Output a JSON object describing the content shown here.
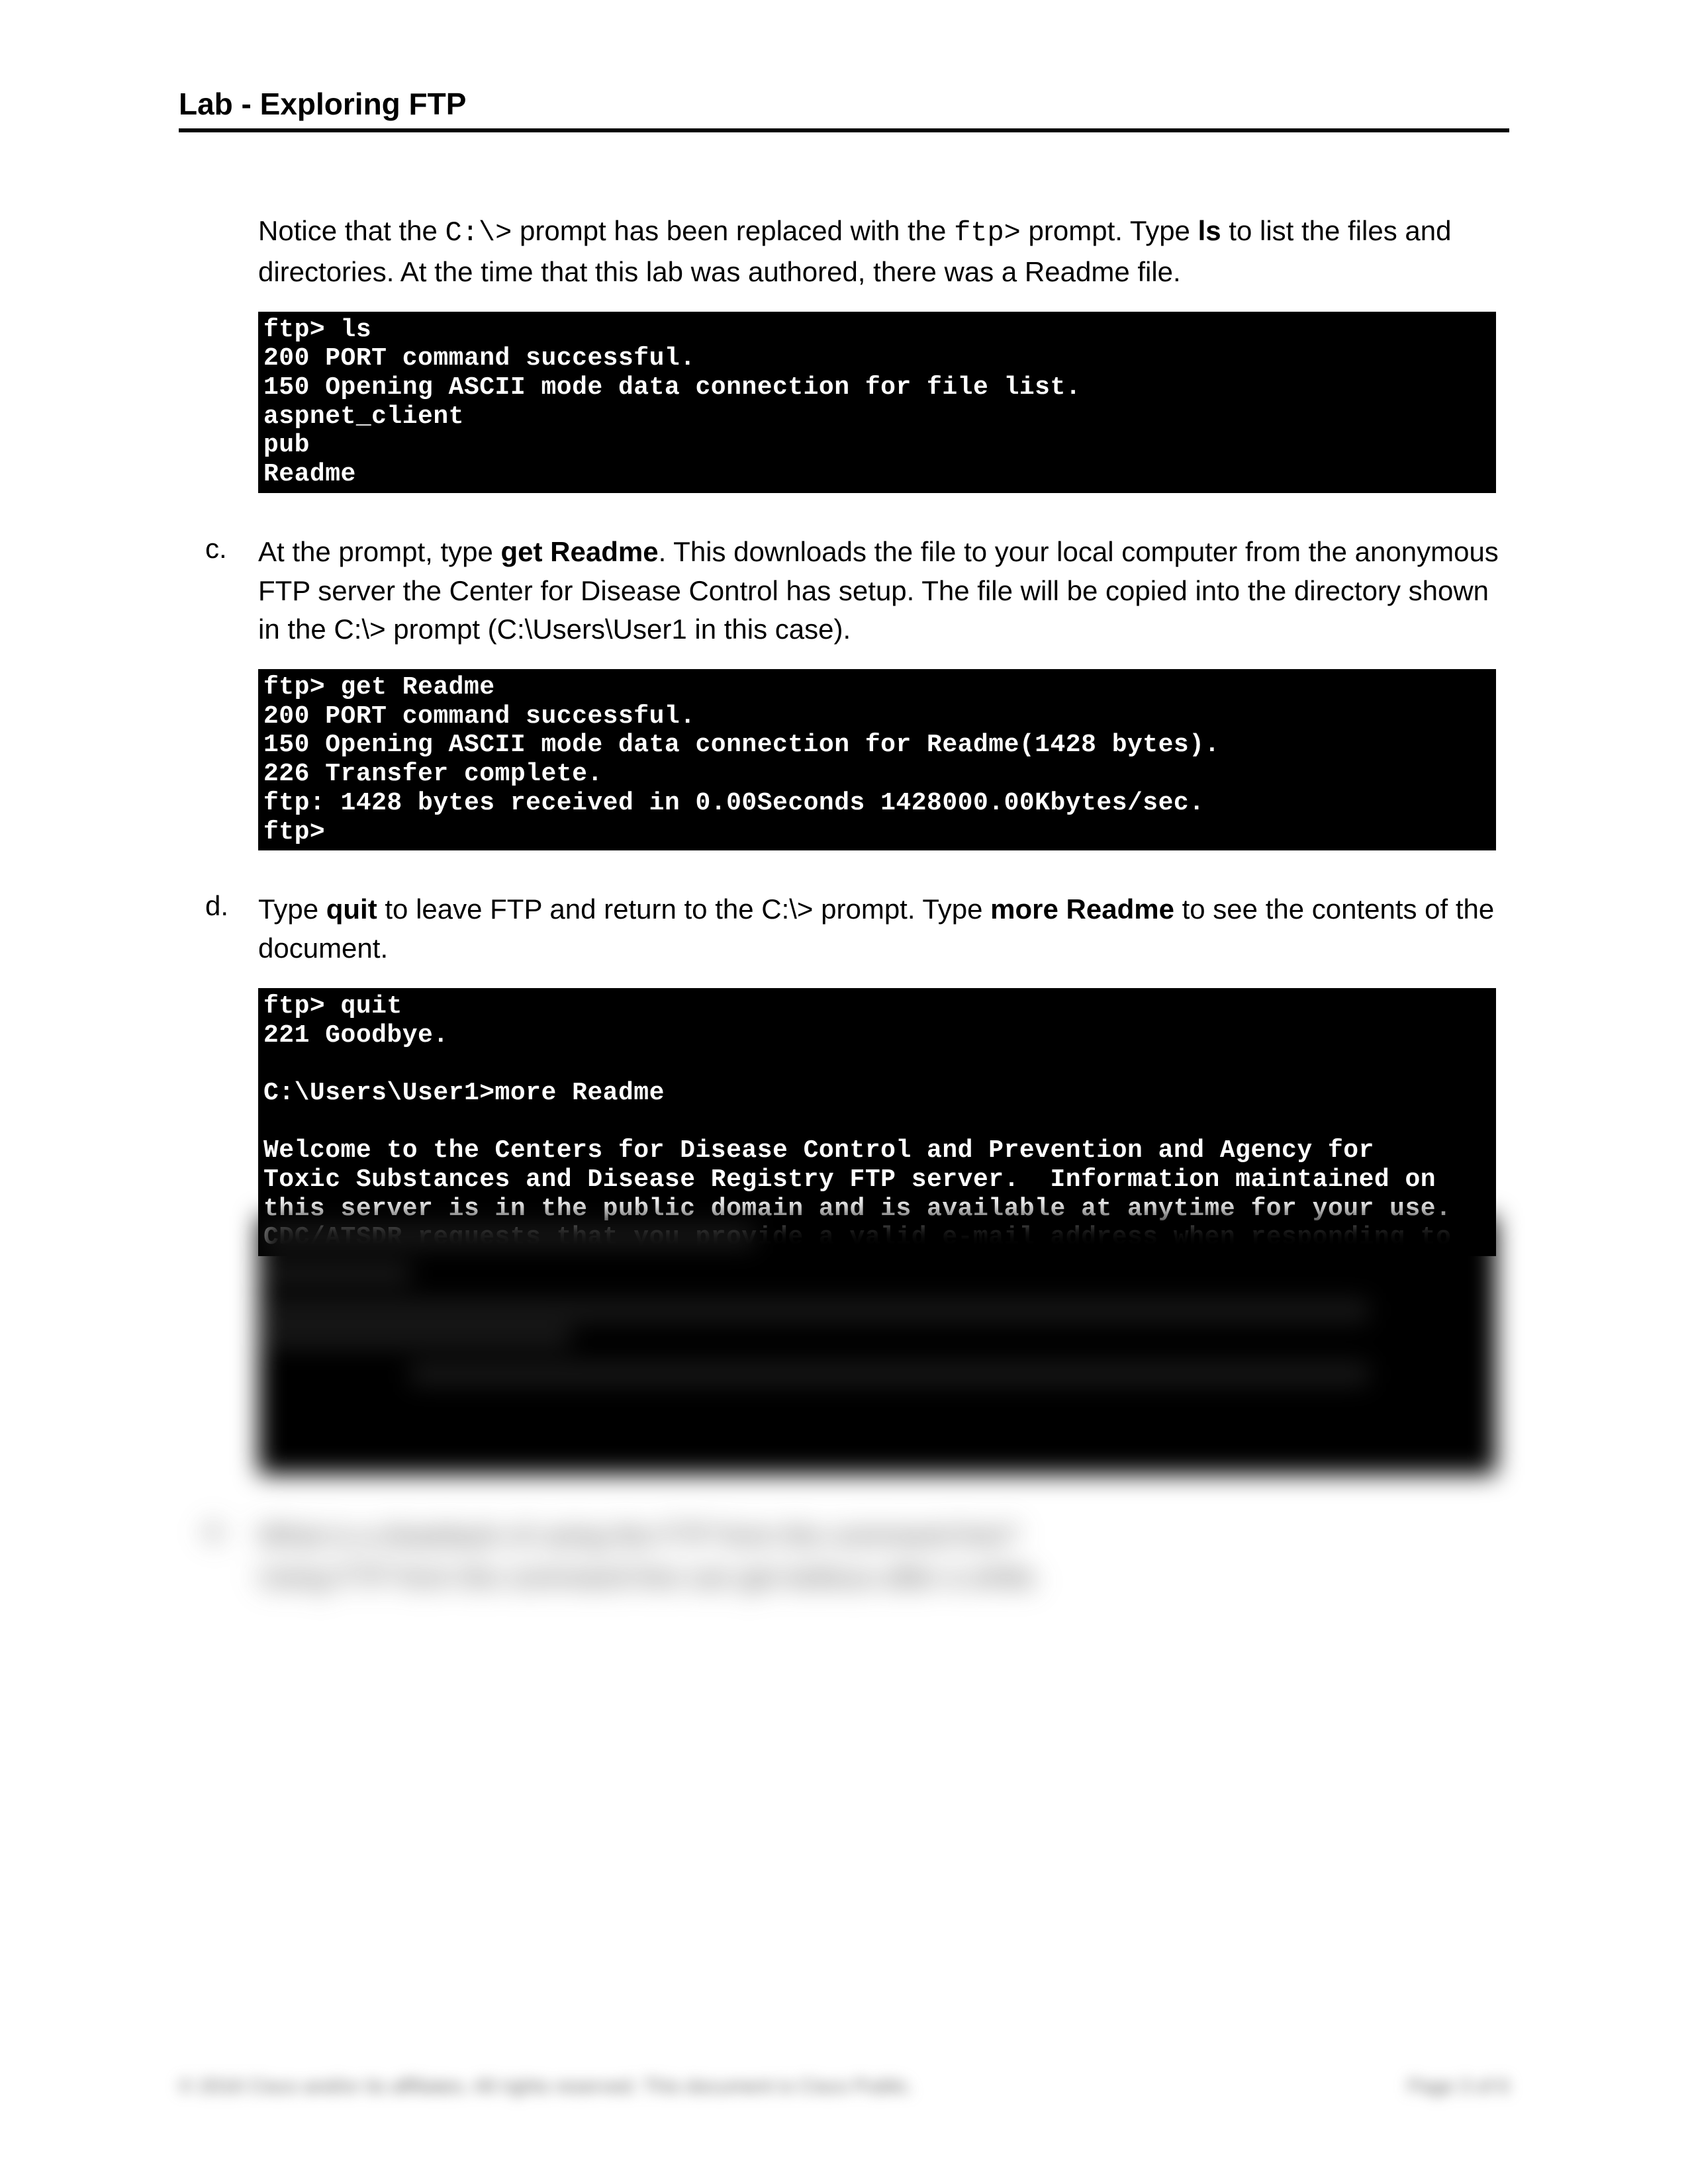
{
  "header": {
    "title": "Lab - Exploring FTP"
  },
  "intro": {
    "pre_text": "Notice that the ",
    "prompt1": "C:\\>",
    "mid_text1": " prompt has been replaced with the ",
    "prompt2": "ftp>",
    "mid_text2": " prompt. Type ",
    "cmd1": "ls",
    "post_text": " to list the files and directories. At the time that this lab was authored, there was a Readme file."
  },
  "terminal1": "ftp> ls\n200 PORT command successful.\n150 Opening ASCII mode data connection for file list.\naspnet_client\npub\nReadme",
  "step_c": {
    "letter": "c.",
    "pre": "At the prompt, type ",
    "cmd": "get Readme",
    "post": ". This downloads the file to your local computer from the anonymous FTP server  the Center for Disease Control has setup. The file will be copied into the directory shown in the C:\\> prompt (C:\\Users\\User1 in this case)."
  },
  "terminal2": "ftp> get Readme\n200 PORT command successful.\n150 Opening ASCII mode data connection for Readme(1428 bytes).\n226 Transfer complete.\nftp: 1428 bytes received in 0.00Seconds 1428000.00Kbytes/sec.\nftp>",
  "step_d": {
    "letter": "d.",
    "pre": "Type ",
    "cmd1": "quit",
    "mid": " to leave FTP and return to the C:\\> prompt. Type ",
    "cmd2": "more Readme",
    "post": " to see the contents of the document."
  },
  "terminal3": "ftp> quit\n221 Goodbye.\n\nC:\\Users\\User1>more Readme\n\nWelcome to the Centers for Disease Control and Prevention and Agency for\nToxic Substances and Disease Registry FTP server.  Information maintained on\nthis server is in the public domain and is available at anytime for your use.\nCDC/ATSDR requests that you provide a valid e-mail address when responding to",
  "blurred_step": {
    "letter": "e.",
    "line1": "What is a drawback of using the FTP from the command line?",
    "line2": "Using FTP from the command line can get tedious after a while."
  },
  "footer": {
    "left": "© 2016 Cisco and/or its affiliates. All rights reserved. This document is Cisco Public.",
    "right": "Page 3 of 6"
  }
}
